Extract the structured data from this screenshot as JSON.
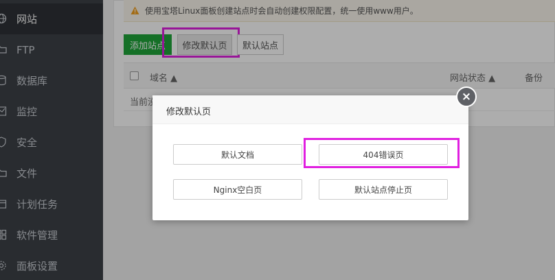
{
  "sidebar": {
    "items": [
      {
        "label": "网站",
        "icon": "globe-icon",
        "active": true
      },
      {
        "label": "FTP",
        "icon": "folder-icon"
      },
      {
        "label": "数据库",
        "icon": "database-icon"
      },
      {
        "label": "监控",
        "icon": "monitor-icon"
      },
      {
        "label": "安全",
        "icon": "shield-icon"
      },
      {
        "label": "文件",
        "icon": "folder-icon"
      },
      {
        "label": "计划任务",
        "icon": "calendar-icon"
      },
      {
        "label": "软件管理",
        "icon": "grid-icon"
      },
      {
        "label": "面板设置",
        "icon": "gear-icon"
      }
    ]
  },
  "notice": {
    "icon": "warning-icon",
    "text": "使用宝塔Linux面板创建站点时会自动创建权限配置，统一使用www用户。"
  },
  "toolbar": {
    "add_site": "添加站点",
    "modify_default": "修改默认页",
    "default_site": "默认站点"
  },
  "table": {
    "headers": {
      "domain": "域名 ▲",
      "status": "网站状态 ▲",
      "backup": "备份"
    },
    "row_text": "当前没"
  },
  "modal": {
    "title": "修改默认页",
    "close_icon": "close-icon",
    "options": [
      "默认文档",
      "404错误页",
      "Nginx空白页",
      "默认站点停止页"
    ]
  },
  "colors": {
    "sidebar_bg": "#3d4148",
    "accent_green": "#20a53a",
    "highlight": "#e01fe0"
  }
}
